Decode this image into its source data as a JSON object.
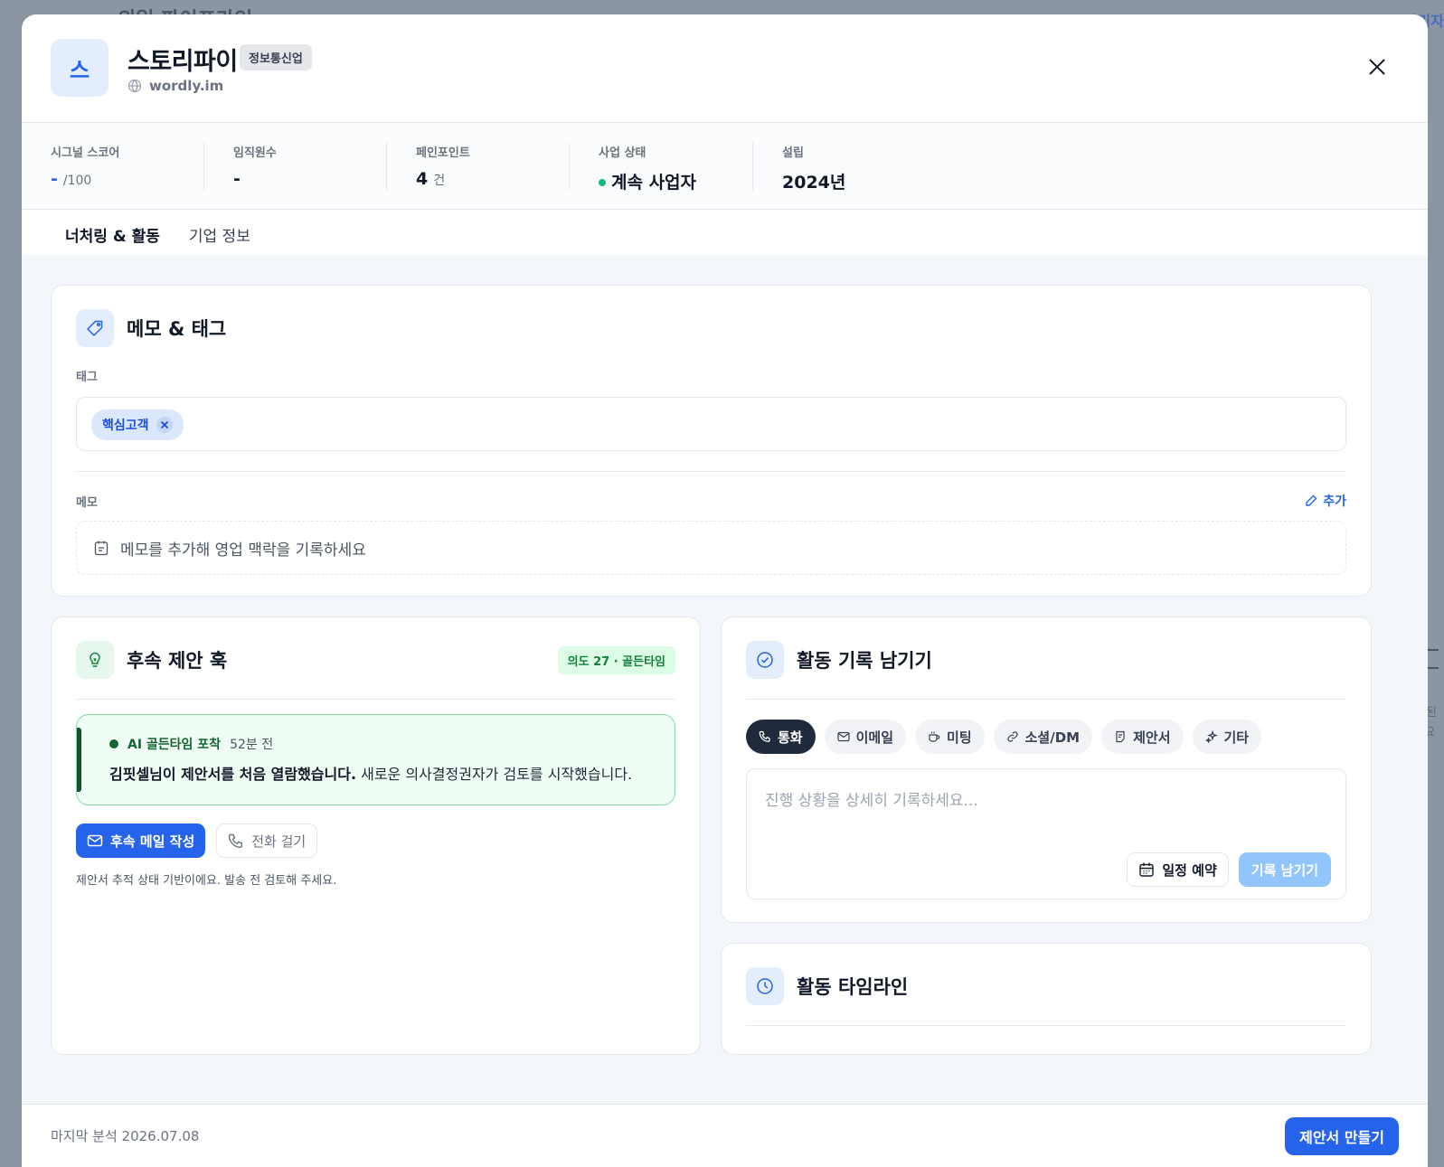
{
  "background": {
    "title": "의일 파이프라인",
    "right_text": "관리자",
    "side_text_1": "남된",
    "side_text_2": "요"
  },
  "company": {
    "logo_letter": "스",
    "name": "스토리파이",
    "industry": "정보통신업",
    "website": "wordly.im"
  },
  "stats": {
    "signal_score": {
      "label": "시그널 스코어",
      "value": "-",
      "unit": "/100"
    },
    "employees": {
      "label": "임직원수",
      "value": "-"
    },
    "pain_points": {
      "label": "페인포인트",
      "value": "4",
      "unit": "건"
    },
    "business_status": {
      "label": "사업 상태",
      "value": "계속 사업자",
      "color": "#10b981"
    },
    "founded": {
      "label": "설립",
      "value": "2024년"
    }
  },
  "tabs": [
    {
      "label": "너처링 & 활동",
      "active": true
    },
    {
      "label": "기업 정보",
      "active": false
    }
  ],
  "memo_tags": {
    "title": "메모 & 태그",
    "tags_label": "태그",
    "tags": [
      "핵심고객"
    ],
    "memo_label": "메모",
    "add_label": "추가",
    "memo_placeholder": "메모를 추가해 영업 맥락을 기록하세요"
  },
  "followup": {
    "title": "후속 제안 훅",
    "badge": "의도 27 · 골든타임",
    "alert_label": "AI 골든타임 포착",
    "alert_time": "52분 전",
    "alert_msg_bold": "김핏셀님이 제안서를 처음 열람했습니다.",
    "alert_msg_rest": " 새로운 의사결정권자가 검토를 시작했습니다.",
    "primary_button": "후속 메일 작성",
    "secondary_button": "전화 걸기",
    "helper": "제안서 추적 상태 기반이에요. 발송 전 검토해 주세요."
  },
  "activity_log": {
    "title": "활동 기록 남기기",
    "types": [
      {
        "label": "통화",
        "icon": "phone-icon",
        "active": true
      },
      {
        "label": "이메일",
        "icon": "mail-icon",
        "active": false
      },
      {
        "label": "미팅",
        "icon": "coffee-icon",
        "active": false
      },
      {
        "label": "소셜/DM",
        "icon": "link-icon",
        "active": false
      },
      {
        "label": "제안서",
        "icon": "document-icon",
        "active": false
      },
      {
        "label": "기타",
        "icon": "sparkle-icon",
        "active": false
      }
    ],
    "placeholder": "진행 상황을 상세히 기록하세요...",
    "schedule_button": "일정 예약",
    "submit_button": "기록 남기기"
  },
  "timeline": {
    "title": "활동 타임라인"
  },
  "footer": {
    "last_analysis": "마지막 분석 2026.07.08",
    "proposal_button": "제안서 만들기"
  },
  "colors": {
    "accent": "#2563eb",
    "success": "#10b981",
    "dark_chip": "#1f2b3d"
  }
}
